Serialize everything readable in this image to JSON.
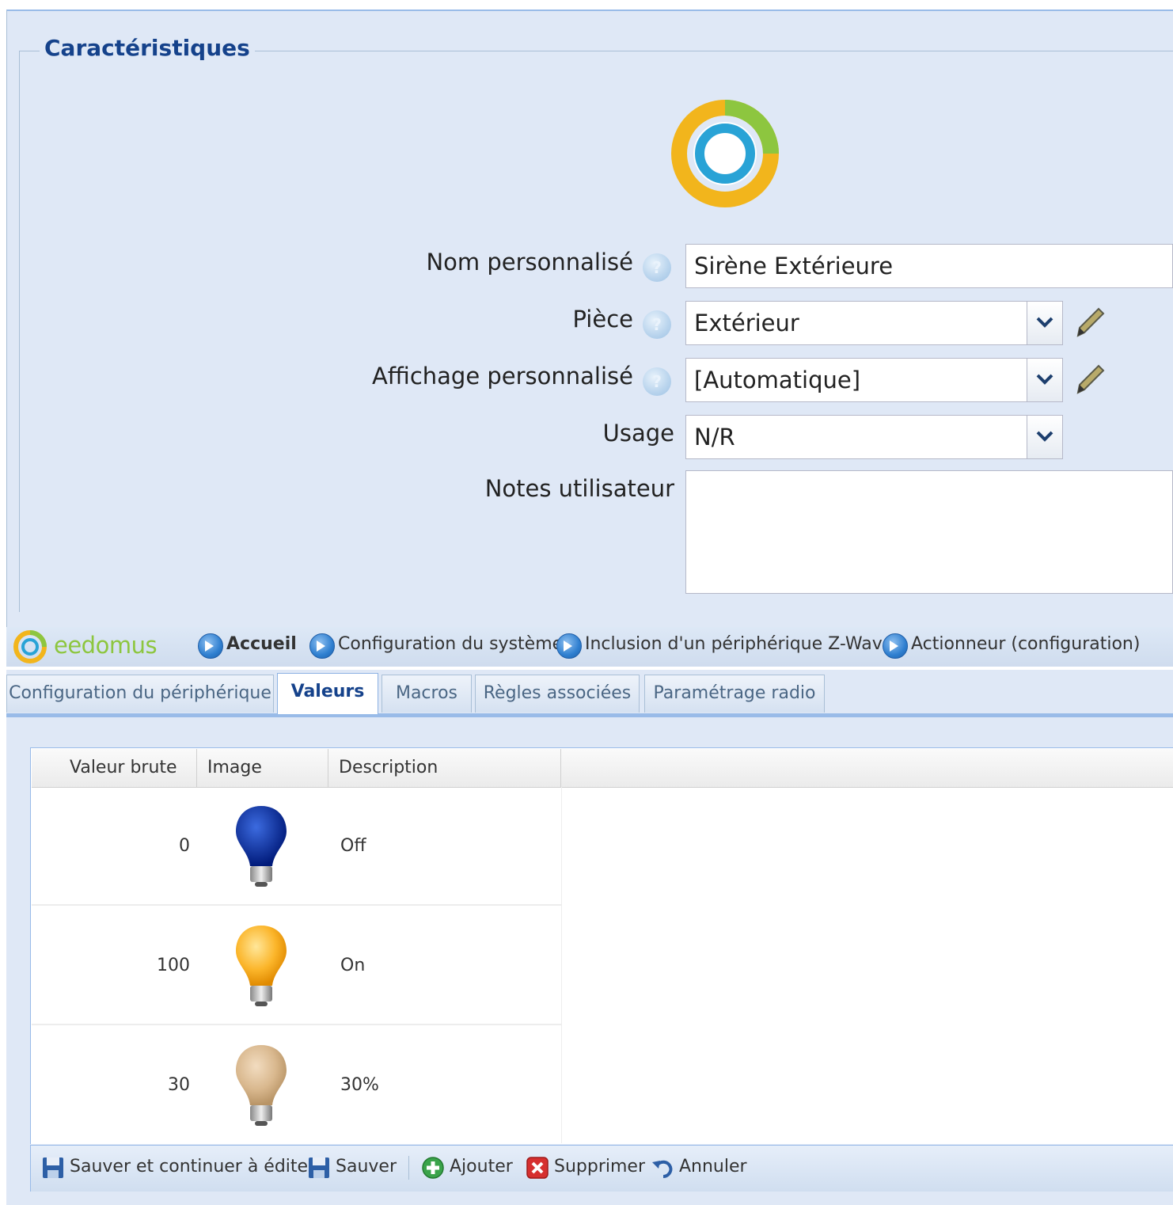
{
  "fieldset": {
    "legend": "Caractéristiques"
  },
  "form": {
    "name_label": "Nom personnalisé",
    "name_value": "Sirène Extérieure",
    "room_label": "Pièce",
    "room_value": "Extérieur",
    "display_label": "Affichage personnalisé",
    "display_value": "[Automatique]",
    "usage_label": "Usage",
    "usage_value": "N/R",
    "notes_label": "Notes utilisateur",
    "notes_value": "",
    "help_glyph": "?"
  },
  "header": {
    "brand": "eedomus",
    "breadcrumbs": [
      "Accueil",
      "Configuration du système",
      "Inclusion d'un périphérique Z-Wave",
      "Actionneur (configuration)"
    ]
  },
  "tabs": [
    {
      "label": "Configuration du périphérique",
      "active": false
    },
    {
      "label": "Valeurs",
      "active": true
    },
    {
      "label": "Macros",
      "active": false
    },
    {
      "label": "Règles associées",
      "active": false
    },
    {
      "label": "Paramétrage radio",
      "active": false
    }
  ],
  "grid": {
    "columns": [
      "Valeur brute",
      "Image",
      "Description"
    ],
    "rows": [
      {
        "raw": "0",
        "image": "bulb-blue-icon",
        "description": "Off"
      },
      {
        "raw": "100",
        "image": "bulb-yellow-icon",
        "description": "On"
      },
      {
        "raw": "30",
        "image": "bulb-beige-icon",
        "description": "30%"
      }
    ]
  },
  "toolbar": {
    "save_continue": "Sauver et continuer à éditer",
    "save": "Sauver",
    "add": "Ajouter",
    "delete": "Supprimer",
    "cancel": "Annuler"
  },
  "colors": {
    "panel_bg": "#dfe8f6",
    "legend": "#15428b",
    "brand_green": "#8dc63f",
    "logo_yellow": "#f2b51c",
    "logo_green": "#8dc63f",
    "logo_blue": "#29a3d6"
  },
  "icons": {
    "help": "help-icon",
    "pencil": "pencil-icon",
    "breadcrumb": "arrow-circle-icon",
    "save": "floppy-disk-icon",
    "add": "plus-circle-icon",
    "delete": "red-x-icon",
    "cancel": "undo-arrow-icon"
  }
}
